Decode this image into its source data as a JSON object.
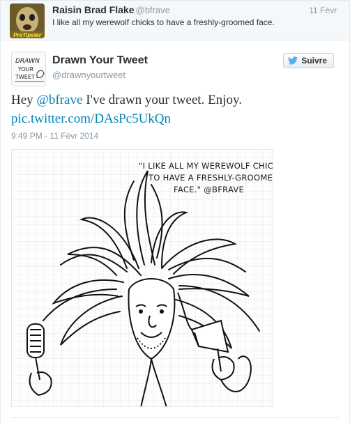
{
  "reply_tweet": {
    "avatar_label": "ProTipster",
    "name": "Raisin Brad Flake",
    "handle": "@bfrave",
    "time": "11 Févr",
    "text": "I like all my werewolf chicks to have a freshly-groomed face."
  },
  "main_tweet": {
    "avatar_lines": [
      "DRAWN",
      "YOUR",
      "TWEET"
    ],
    "name": "Drawn Your Tweet",
    "handle": "@drawnyourtweet",
    "follow_label": "Suivre",
    "text_prefix": "Hey ",
    "mention": "@bfrave",
    "text_body": " I've drawn your tweet. Enjoy. ",
    "link": "pic.twitter.com/DAsPc5UkQn",
    "timestamp": "9:49 PM - 11 Févr 2014"
  },
  "drawing": {
    "caption_lines": [
      "\"I LIKE ALL MY WEREWOLF CHICKS",
      "TO HAVE A FRESHLY-GROOMED",
      "FACE.\" @BFRAVE"
    ]
  },
  "colors": {
    "link": "#0084b4",
    "muted": "#8899a6",
    "text": "#292f33",
    "twitter_blue": "#55acee"
  }
}
